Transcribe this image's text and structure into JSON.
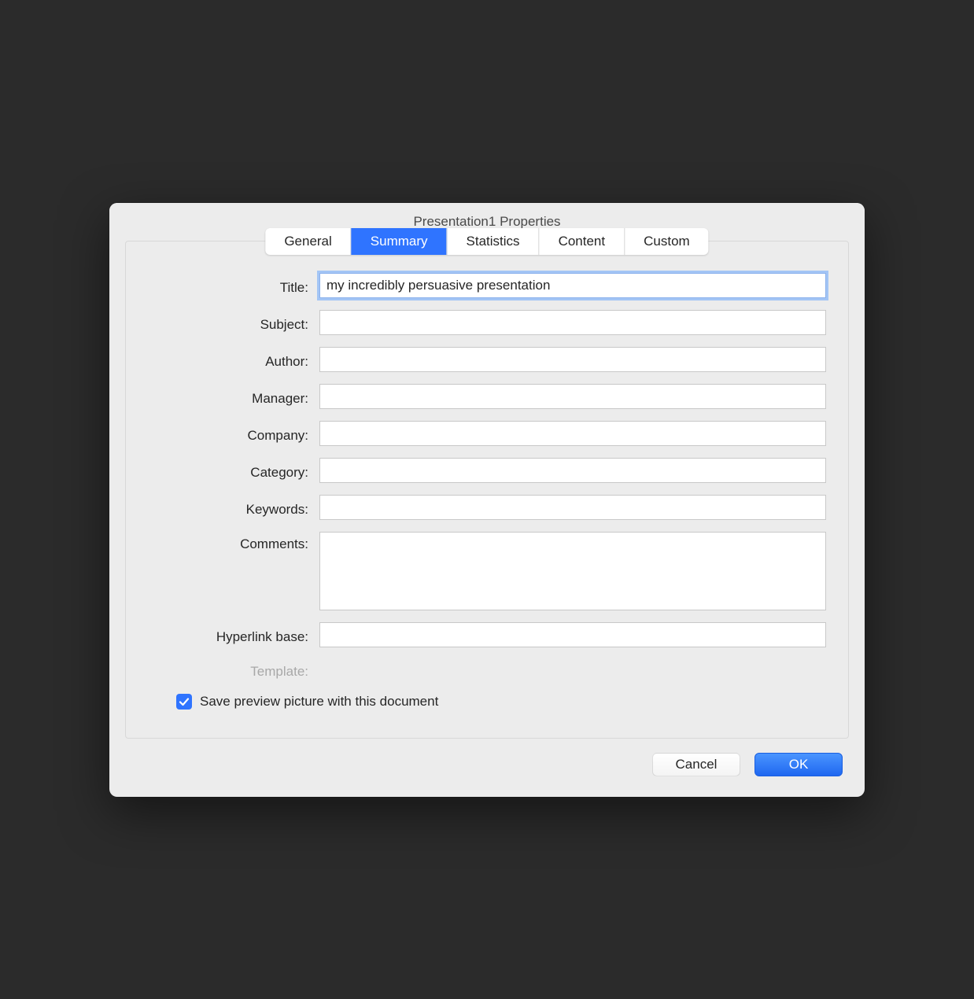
{
  "dialog": {
    "title": "Presentation1 Properties"
  },
  "tabs": {
    "general": "General",
    "summary": "Summary",
    "statistics": "Statistics",
    "content": "Content",
    "custom": "Custom"
  },
  "labels": {
    "title": "Title:",
    "subject": "Subject:",
    "author": "Author:",
    "manager": "Manager:",
    "company": "Company:",
    "category": "Category:",
    "keywords": "Keywords:",
    "comments": "Comments:",
    "hyperlink_base": "Hyperlink base:",
    "template": "Template:"
  },
  "fields": {
    "title": "my incredibly persuasive presentation",
    "subject": "",
    "author": "",
    "manager": "",
    "company": "",
    "category": "",
    "keywords": "",
    "comments": "",
    "hyperlink_base": ""
  },
  "checkbox": {
    "save_preview_label": "Save preview picture with this document",
    "save_preview_checked": true
  },
  "buttons": {
    "cancel": "Cancel",
    "ok": "OK"
  }
}
